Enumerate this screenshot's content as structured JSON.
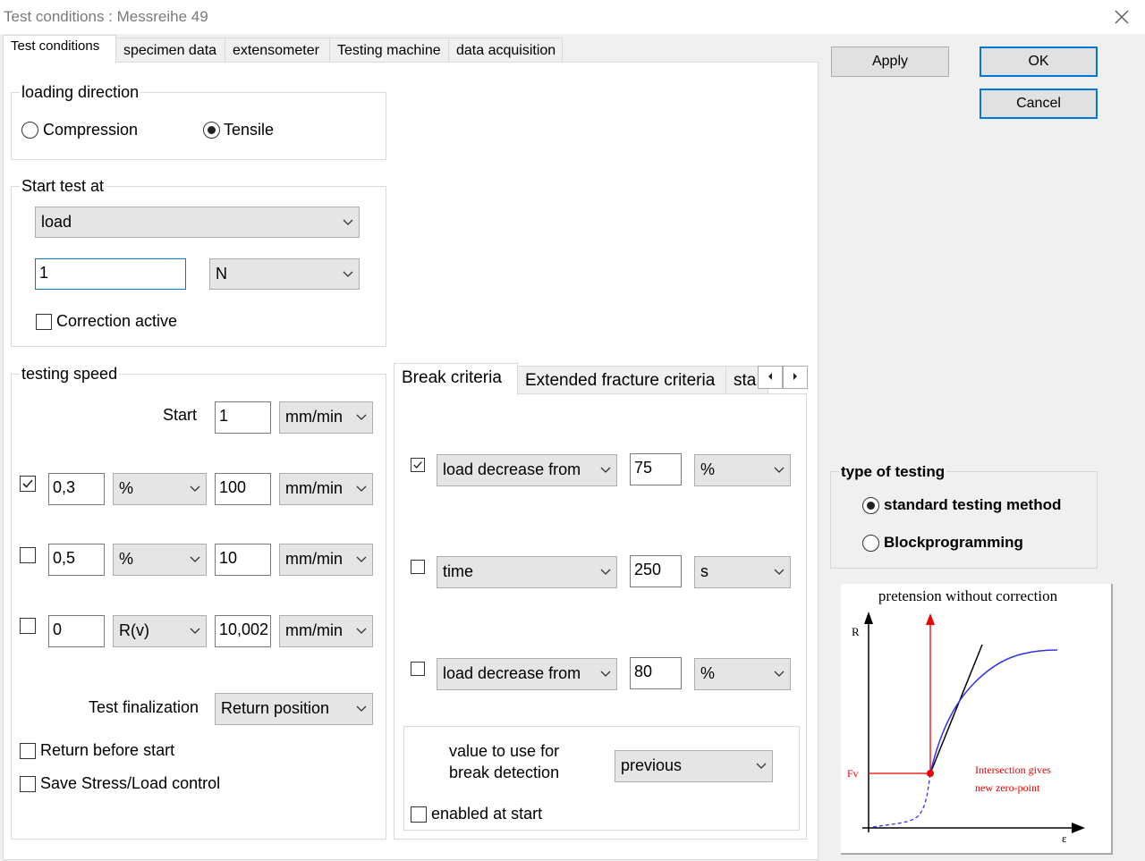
{
  "window": {
    "title": "Test conditions : Messreihe 49"
  },
  "tabs": [
    "Test conditions",
    "specimen data",
    "extensometer",
    "Testing machine",
    "data acquisition"
  ],
  "buttons": {
    "apply": "Apply",
    "ok": "OK",
    "cancel": "Cancel"
  },
  "loading_direction": {
    "label": "loading direction",
    "compression": "Compression",
    "tensile": "Tensile",
    "selected": "Tensile"
  },
  "start_test": {
    "label": "Start test at",
    "mode": "load",
    "value": "1",
    "unit": "N",
    "correction_label": "Correction active",
    "correction_checked": false
  },
  "testing_speed": {
    "label": "testing speed",
    "start_label": "Start",
    "start_value": "1",
    "start_unit": "mm/min",
    "rows": [
      {
        "checked": true,
        "value": "0,3",
        "ref": "%",
        "speed": "100",
        "unit": "mm/min"
      },
      {
        "checked": false,
        "value": "0,5",
        "ref": "%",
        "speed": "10",
        "unit": "mm/min"
      },
      {
        "checked": false,
        "value": "0",
        "ref": "R(v)",
        "speed": "10,002",
        "unit": "mm/min"
      }
    ],
    "finalization_label": "Test finalization",
    "finalization_value": "Return position",
    "return_before_start": "Return before start",
    "save_control": "Save Stress/Load control"
  },
  "break": {
    "tabs": [
      "Break criteria",
      "Extended fracture criteria",
      "sta"
    ],
    "rows": [
      {
        "checked": true,
        "criterion": "load decrease from",
        "value": "75",
        "unit": "%"
      },
      {
        "checked": false,
        "criterion": "time",
        "value": "250",
        "unit": "s"
      },
      {
        "checked": false,
        "criterion": "load decrease from",
        "value": "80",
        "unit": "%"
      }
    ],
    "detection_label_1": "value to use for",
    "detection_label_2": "break detection",
    "detection_value": "previous",
    "enabled_at_start": "enabled at start"
  },
  "type_of_testing": {
    "label": "type of testing",
    "standard": "standard testing method",
    "block": "Blockprogramming",
    "selected": "standard testing method"
  },
  "diagram": {
    "title": "pretension without correction",
    "y_axis": "R",
    "x_axis": "ε",
    "fv_label": "Fv",
    "note_1": "Intersection gives",
    "note_2": "new zero-point"
  },
  "colors": {
    "accent": "#0078d7",
    "curve": "#3333ee",
    "red": "#ee0000"
  }
}
